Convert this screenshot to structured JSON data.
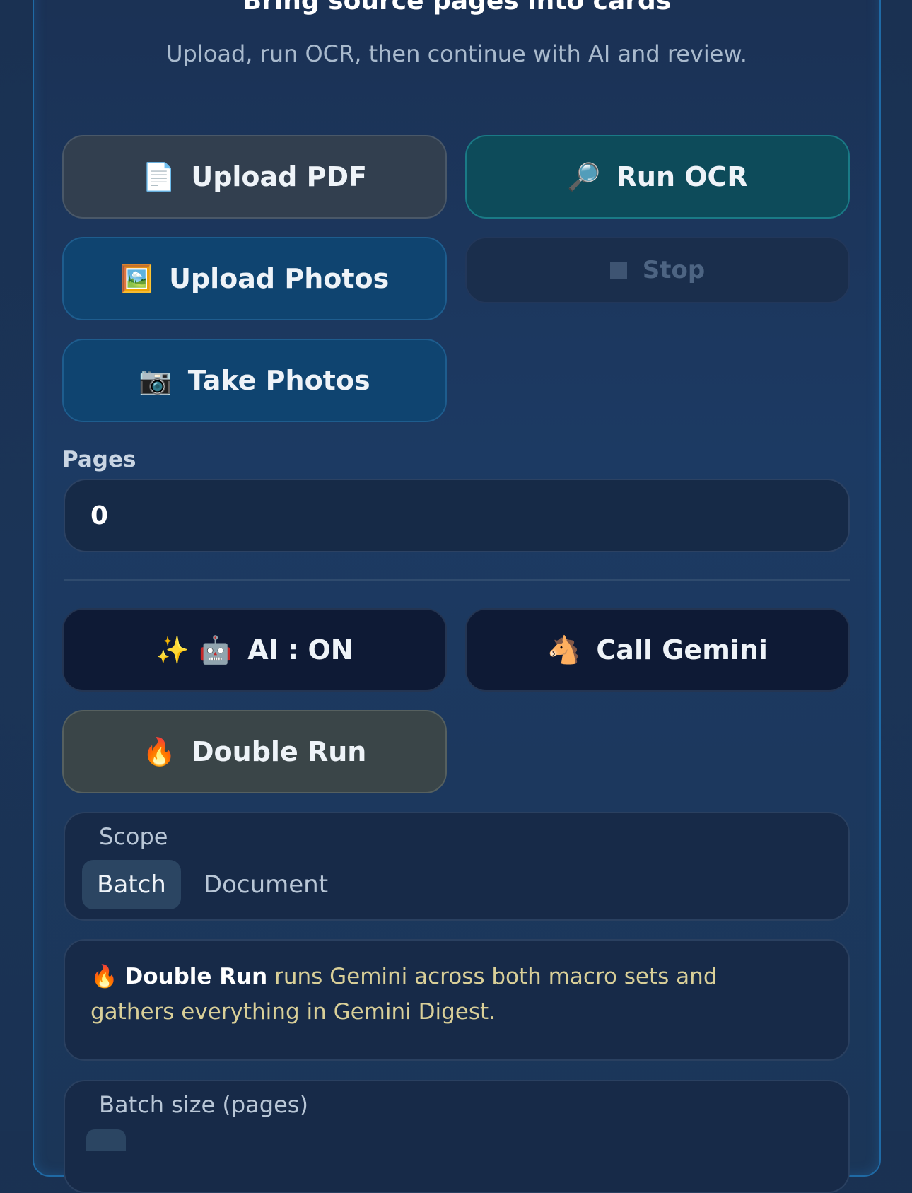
{
  "header": {
    "title": "Bring source pages into cards",
    "subtitle": "Upload, run OCR, then continue with AI and review."
  },
  "buttons": {
    "upload_pdf": {
      "icon": "📄",
      "label": "Upload PDF"
    },
    "run_ocr": {
      "icon": "🔎",
      "label": "Run OCR"
    },
    "upload_photos": {
      "icon": "🖼️",
      "label": "Upload Photos"
    },
    "stop": {
      "label": "Stop"
    },
    "take_photos": {
      "icon": "📷",
      "label": "Take Photos"
    },
    "ai_toggle": {
      "icon": "✨ 🤖",
      "label": "AI : ON"
    },
    "call_gemini": {
      "icon": "🐴",
      "label": "Call Gemini"
    },
    "double_run": {
      "icon": "🔥",
      "label": "Double Run"
    }
  },
  "pages": {
    "label": "Pages",
    "value": "0"
  },
  "scope": {
    "title": "Scope",
    "options": [
      "Batch",
      "Document"
    ],
    "selected": "Batch"
  },
  "info": {
    "icon": "🔥",
    "bold": "Double Run",
    "text": " runs Gemini across both macro sets and gathers everything in Gemini Digest."
  },
  "batch_size": {
    "title": "Batch size (pages)"
  },
  "colors": {
    "accent_border": "#1f6aa5",
    "teal_button": "#0d4b5a",
    "blue_button": "#0f4470",
    "info_text": "#d9cf98"
  }
}
